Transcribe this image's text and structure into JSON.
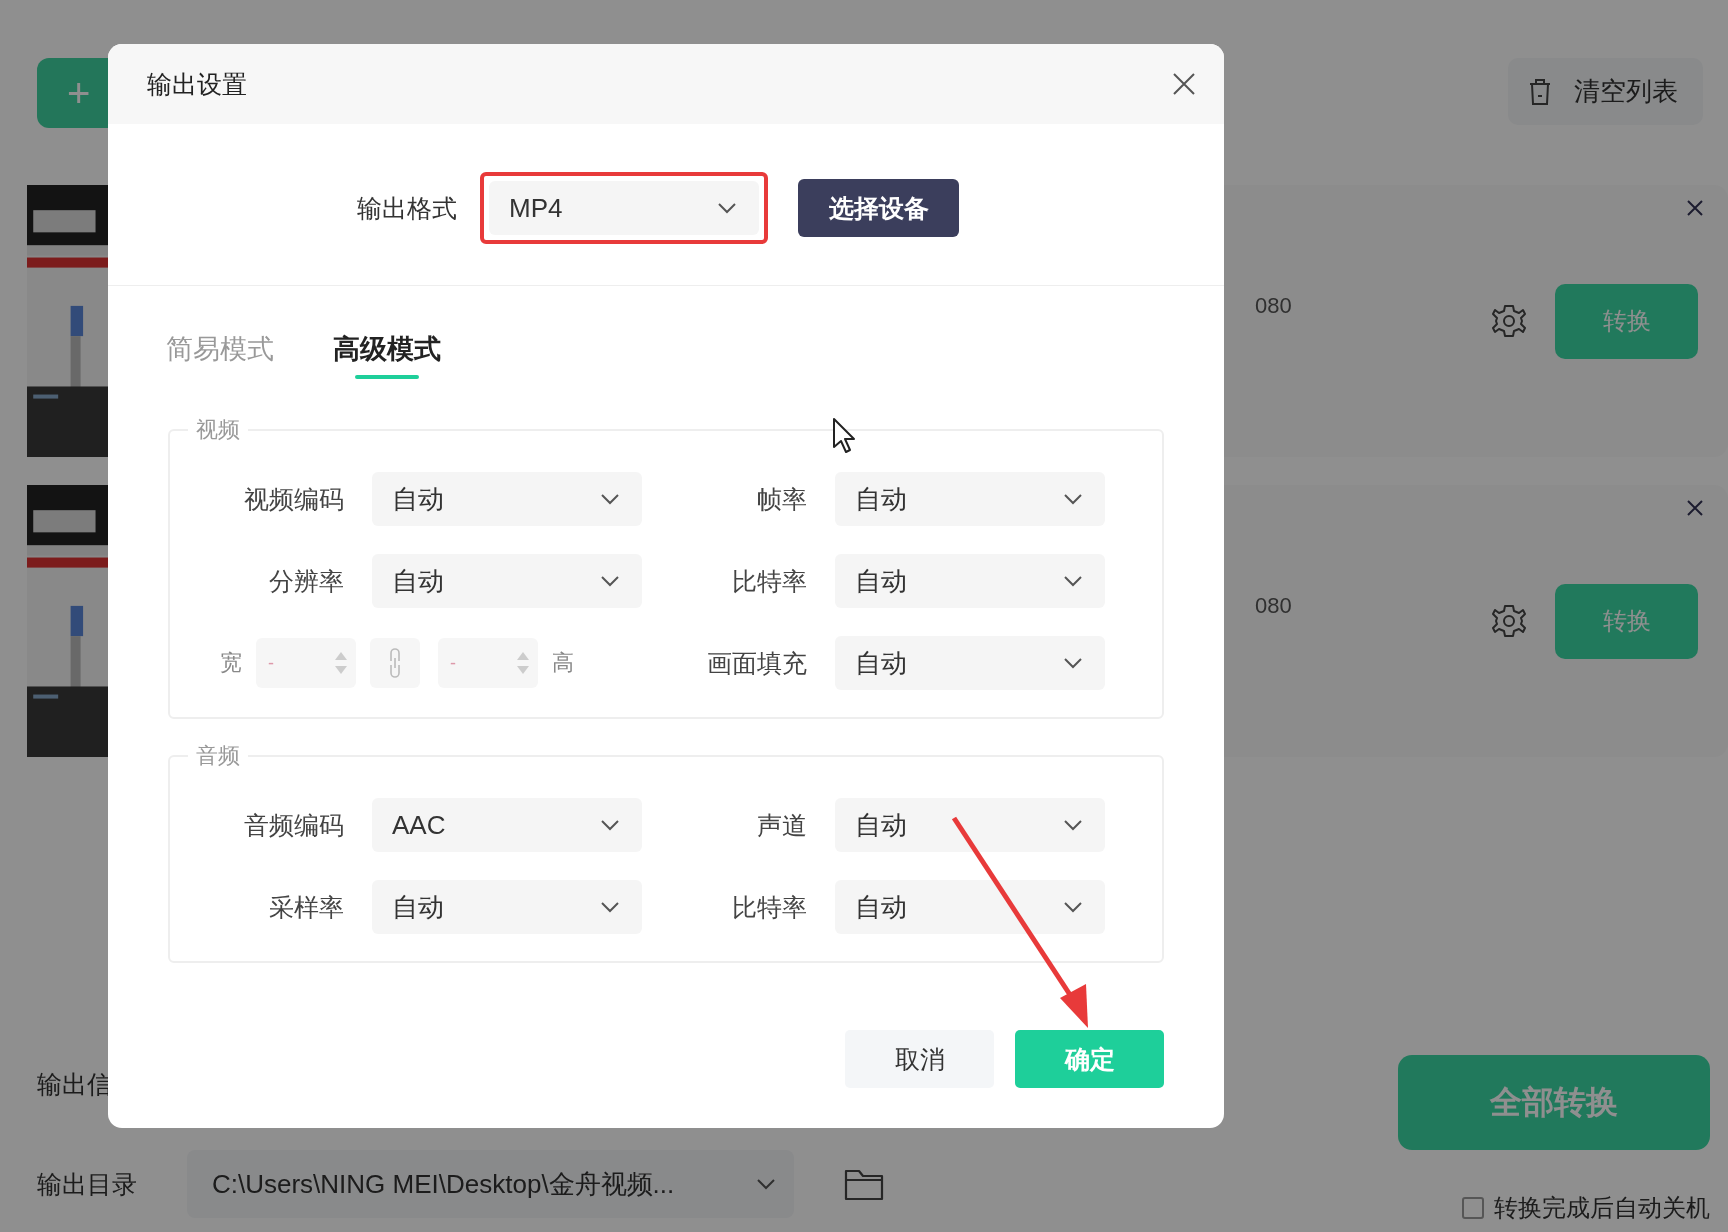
{
  "background": {
    "add_button": {
      "icon": "+"
    },
    "clear_button": {
      "label": "清空列表"
    },
    "tasks": [
      {
        "resolution": "080",
        "convert_label": "转换"
      },
      {
        "resolution": "080",
        "convert_label": "转换"
      }
    ],
    "output_info_label": "输出信",
    "output_dir": {
      "label": "输出目录",
      "value": "C:\\Users\\NING MEI\\Desktop\\金舟视频..."
    },
    "convert_all": "全部转换",
    "auto_shutdown": {
      "label": "转换完成后自动关机",
      "checked": false
    }
  },
  "dialog": {
    "title": "输出设置",
    "format": {
      "label": "输出格式",
      "value": "MP4",
      "highlighted": true
    },
    "device_button": "选择设备",
    "tabs": [
      {
        "label": "简易模式",
        "selected": false
      },
      {
        "label": "高级模式",
        "selected": true
      }
    ],
    "groups": [
      {
        "title": "视频",
        "fields": [
          {
            "kind": "select",
            "label": "视频编码",
            "value": "自动"
          },
          {
            "kind": "select",
            "label": "帧率",
            "value": "自动"
          },
          {
            "kind": "select",
            "label": "分辨率",
            "value": "自动"
          },
          {
            "kind": "select",
            "label": "比特率",
            "value": "自动"
          },
          {
            "kind": "size",
            "width_label": "宽",
            "width_value": "-",
            "height_value": "-",
            "height_label": "高"
          },
          {
            "kind": "select",
            "label": "画面填充",
            "value": "自动"
          }
        ]
      },
      {
        "title": "音频",
        "fields": [
          {
            "kind": "select",
            "label": "音频编码",
            "value": "AAC"
          },
          {
            "kind": "select",
            "label": "声道",
            "value": "自动"
          },
          {
            "kind": "select",
            "label": "采样率",
            "value": "自动"
          },
          {
            "kind": "select",
            "label": "比特率",
            "value": "自动"
          }
        ]
      }
    ],
    "cancel": "取消",
    "ok": "确定"
  }
}
